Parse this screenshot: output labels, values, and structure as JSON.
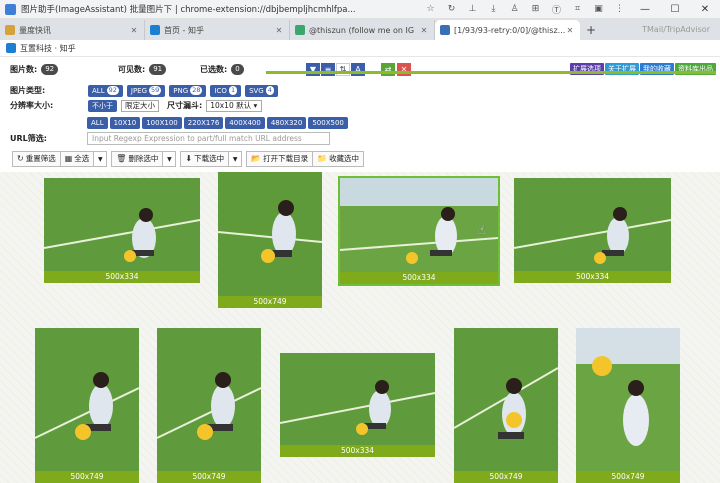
{
  "window": {
    "title": "图片助手(ImageAssistant) 批量图片下 | chrome-extension://dbjbempljhcmhlfpa..."
  },
  "tabs": [
    {
      "label": "量度快讯",
      "color": "#d6a23a"
    },
    {
      "label": "首页 - 知乎",
      "color": "#1d7fd1"
    },
    {
      "label": "@thiszun (follow me on IG",
      "color": "#3aa76d"
    },
    {
      "label": "[1/93/93-retry:0/0]/@thisz...",
      "color": "#3a6fb5",
      "active": true
    }
  ],
  "tabstrip_right": "TMail/TripAdvisor",
  "bookmark": {
    "label": "互置科技 · 知乎"
  },
  "extension": {
    "image_count_label": "图片数:",
    "image_count": "92",
    "visible_count_label": "可见数:",
    "visible_count": "91",
    "selected_count_label": "已选数:",
    "selected_count": "0",
    "type_label": "图片类型:",
    "types": [
      {
        "name": "ALL",
        "count": "92"
      },
      {
        "name": "JPEG",
        "count": "59"
      },
      {
        "name": "PNG",
        "count": "28"
      },
      {
        "name": "ICO",
        "count": "1"
      },
      {
        "name": "SVG",
        "count": "4"
      }
    ],
    "resolution_label": "分辨率大小:",
    "res_buttons": [
      "不小于",
      "限定大小"
    ],
    "size_filter_label": "尺寸漏斗:",
    "size_filter_value": "10x10 默认",
    "size_presets": [
      "ALL",
      "10X10",
      "100X100",
      "220X176",
      "400X400",
      "480X320",
      "500X500"
    ],
    "url_label": "URL筛选:",
    "url_placeholder": "Input Regexp Expression to part/full match URL address",
    "toolbar": [
      {
        "icon": "↻",
        "label": "重置筛选"
      },
      {
        "icon": "▦",
        "label": "全选"
      },
      {
        "icon": "🗑",
        "label": "删除选中"
      },
      {
        "icon": "⬇",
        "label": "下载选中"
      },
      {
        "icon": "📂",
        "label": "打开下载目录"
      },
      {
        "icon": "📁",
        "label": "收藏选中"
      }
    ],
    "right_buttons": [
      {
        "label": "扩展选项",
        "color": "#5b3fa8"
      },
      {
        "label": "关于扩展",
        "color": "#2f9ad6"
      },
      {
        "label": "我的收藏",
        "color": "#2b7bd1"
      },
      {
        "label": "资料库出品",
        "color": "#4fa83d"
      }
    ]
  },
  "gallery": {
    "items": [
      {
        "caption": "500x334"
      },
      {
        "caption": "500x749"
      },
      {
        "caption": "500x334"
      },
      {
        "caption": "500x334"
      },
      {
        "caption": "500x749"
      },
      {
        "caption": "500x749"
      },
      {
        "caption": "500x334"
      },
      {
        "caption": "500x749"
      },
      {
        "caption": "500x749"
      }
    ]
  }
}
